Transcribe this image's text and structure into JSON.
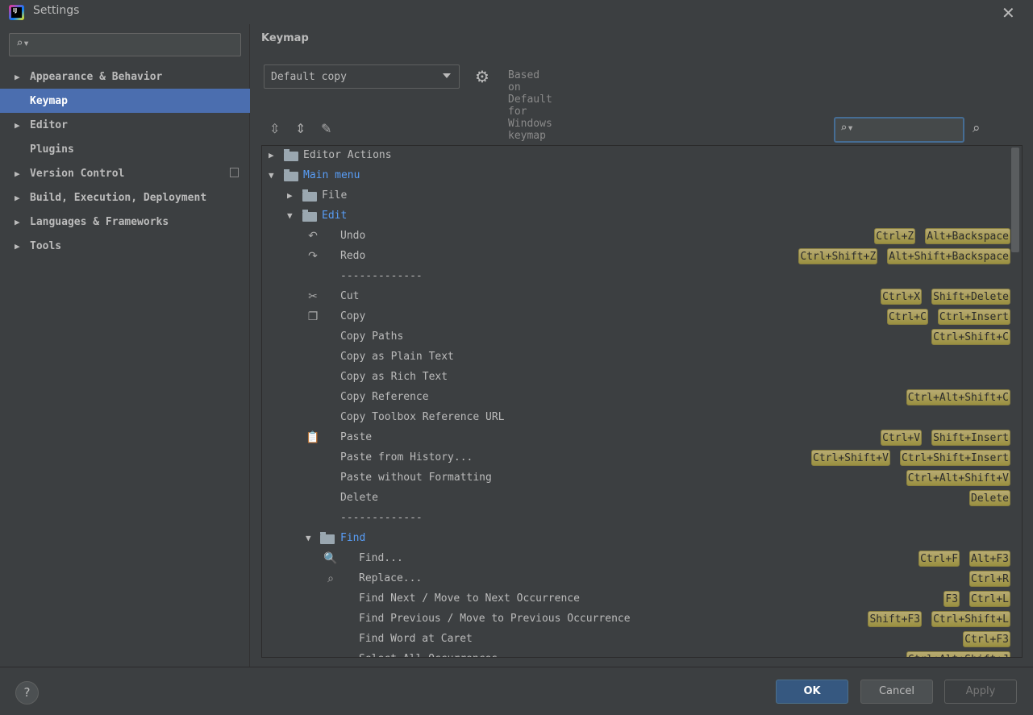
{
  "window": {
    "title": "Settings"
  },
  "sidebar": {
    "search_placeholder": "",
    "items": [
      {
        "label": "Appearance & Behavior",
        "expandable": true
      },
      {
        "label": "Keymap",
        "expandable": false,
        "selected": true
      },
      {
        "label": "Editor",
        "expandable": true
      },
      {
        "label": "Plugins",
        "expandable": false
      },
      {
        "label": "Version Control",
        "expandable": true,
        "project_badge": true
      },
      {
        "label": "Build, Execution, Deployment",
        "expandable": true
      },
      {
        "label": "Languages & Frameworks",
        "expandable": true
      },
      {
        "label": "Tools",
        "expandable": true
      }
    ]
  },
  "main": {
    "heading": "Keymap",
    "keymap_select": "Default copy",
    "based_on": "Based on Default for Windows keymap",
    "filter_value": ""
  },
  "tree": [
    {
      "level": 0,
      "arrow": "right",
      "icon": "editor-actions-folder",
      "label": "Editor Actions",
      "keys": []
    },
    {
      "level": 0,
      "arrow": "down",
      "icon": "main-menu-folder",
      "label": "Main menu",
      "blue": true,
      "keys": []
    },
    {
      "level": 1,
      "arrow": "right",
      "icon": "folder",
      "label": "File",
      "keys": []
    },
    {
      "level": 1,
      "arrow": "down",
      "icon": "folder",
      "label": "Edit",
      "blue": true,
      "keys": []
    },
    {
      "level": 2,
      "icon": "undo",
      "label": "Undo",
      "keys": [
        "Ctrl+Z",
        "Alt+Backspace"
      ]
    },
    {
      "level": 2,
      "icon": "redo",
      "label": "Redo",
      "keys": [
        "Ctrl+Shift+Z",
        "Alt+Shift+Backspace"
      ]
    },
    {
      "level": 2,
      "label": "-------------",
      "keys": []
    },
    {
      "level": 2,
      "icon": "cut",
      "label": "Cut",
      "keys": [
        "Ctrl+X",
        "Shift+Delete"
      ]
    },
    {
      "level": 2,
      "icon": "copy",
      "label": "Copy",
      "keys": [
        "Ctrl+C",
        "Ctrl+Insert"
      ]
    },
    {
      "level": 2,
      "label": "Copy Paths",
      "keys": [
        "Ctrl+Shift+C"
      ]
    },
    {
      "level": 2,
      "label": "Copy as Plain Text",
      "keys": []
    },
    {
      "level": 2,
      "label": "Copy as Rich Text",
      "keys": []
    },
    {
      "level": 2,
      "label": "Copy Reference",
      "keys": [
        "Ctrl+Alt+Shift+C"
      ]
    },
    {
      "level": 2,
      "label": "Copy Toolbox Reference URL",
      "keys": []
    },
    {
      "level": 2,
      "icon": "paste",
      "label": "Paste",
      "keys": [
        "Ctrl+V",
        "Shift+Insert"
      ]
    },
    {
      "level": 2,
      "label": "Paste from History...",
      "keys": [
        "Ctrl+Shift+V",
        "Ctrl+Shift+Insert"
      ]
    },
    {
      "level": 2,
      "label": "Paste without Formatting",
      "keys": [
        "Ctrl+Alt+Shift+V"
      ]
    },
    {
      "level": 2,
      "label": "Delete",
      "keys": [
        "Delete"
      ]
    },
    {
      "level": 2,
      "label": "-------------",
      "keys": []
    },
    {
      "level": 2,
      "arrow": "down",
      "icon": "folder",
      "label": "Find",
      "blue": true,
      "keys": []
    },
    {
      "level": 3,
      "icon": "search",
      "label": "Find...",
      "keys": [
        "Ctrl+F",
        "Alt+F3"
      ]
    },
    {
      "level": 3,
      "icon": "replace",
      "label": "Replace...",
      "keys": [
        "Ctrl+R"
      ]
    },
    {
      "level": 3,
      "label": "Find Next / Move to Next Occurrence",
      "keys": [
        "F3",
        "Ctrl+L"
      ]
    },
    {
      "level": 3,
      "label": "Find Previous / Move to Previous Occurrence",
      "keys": [
        "Shift+F3",
        "Ctrl+Shift+L"
      ]
    },
    {
      "level": 3,
      "label": "Find Word at Caret",
      "keys": [
        "Ctrl+F3"
      ]
    },
    {
      "level": 3,
      "label": "Select All Occurrences",
      "keys": [
        "Ctrl+Alt+Shift+J"
      ]
    }
  ],
  "footer": {
    "help": "?",
    "ok": "OK",
    "cancel": "Cancel",
    "apply": "Apply"
  },
  "colors": {
    "selection": "#4b6eaf",
    "link": "#589df6",
    "shortcut_badge": "#a39a4b",
    "ok_button": "#365880"
  }
}
